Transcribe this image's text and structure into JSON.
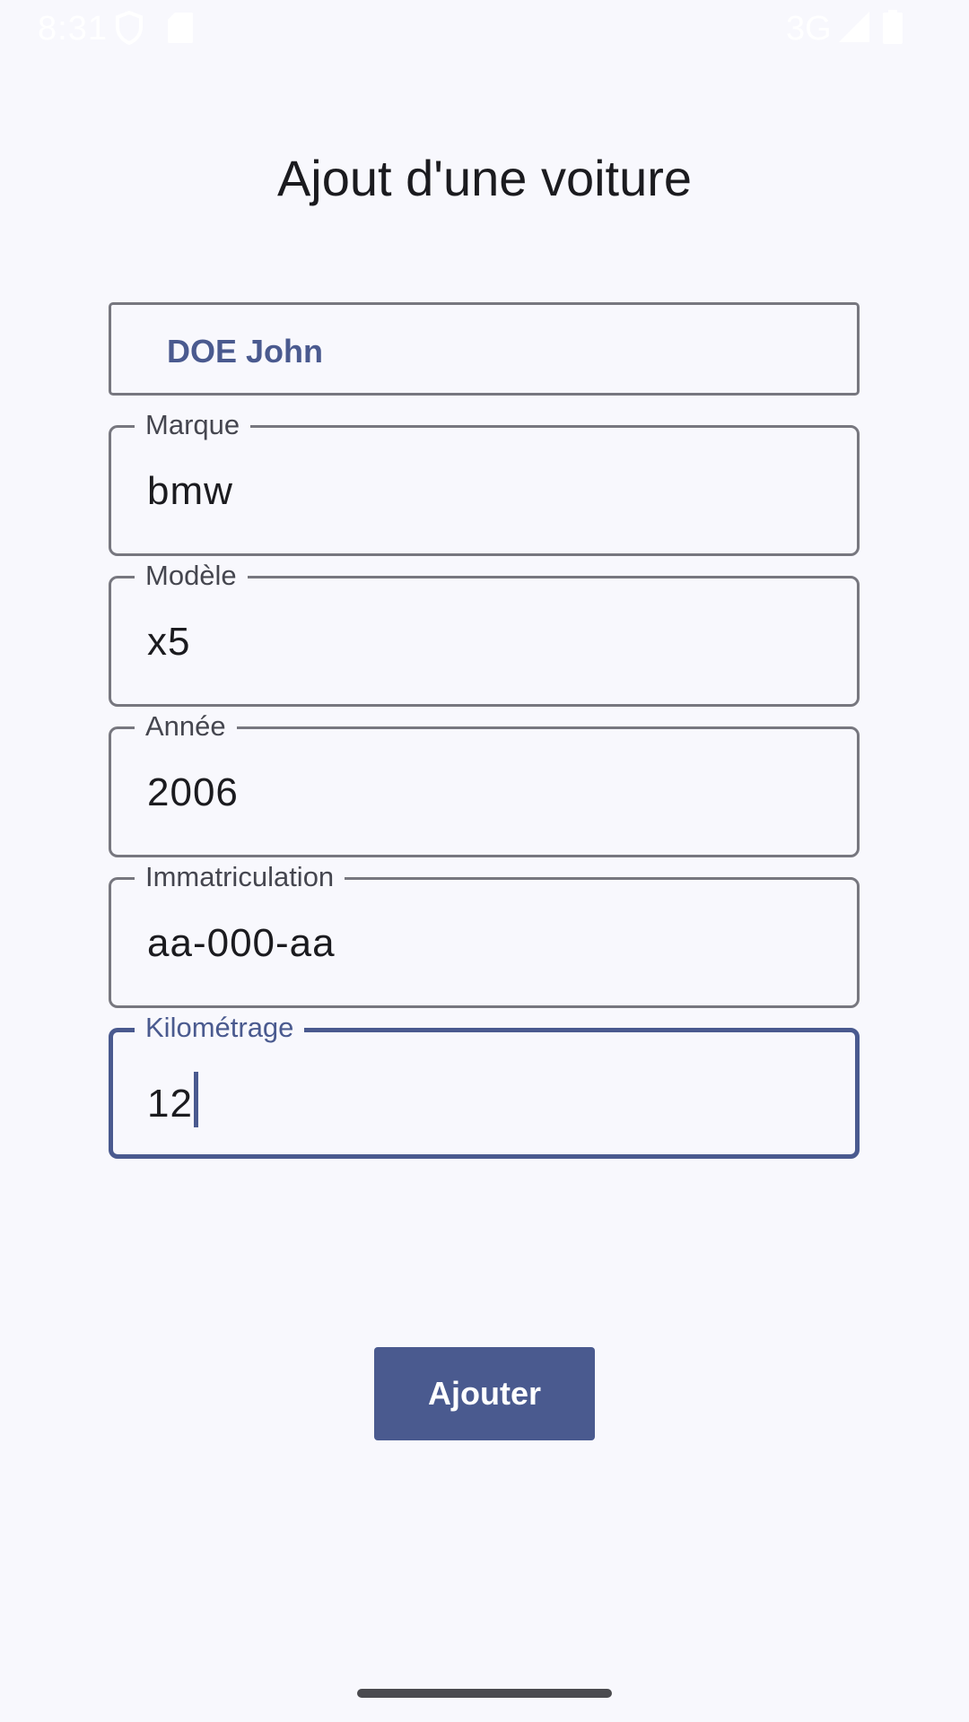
{
  "status_bar": {
    "time": "8:31",
    "network": "3G",
    "icons": [
      "shield-icon",
      "sd-card-icon",
      "signal-icon",
      "battery-icon"
    ]
  },
  "page": {
    "title": "Ajout d'une voiture"
  },
  "owner": {
    "selected": "DOE John"
  },
  "fields": {
    "marque": {
      "label": "Marque",
      "value": "bmw"
    },
    "modele": {
      "label": "Modèle",
      "value": "x5"
    },
    "annee": {
      "label": "Année",
      "value": "2006"
    },
    "immatriculation": {
      "label": "Immatriculation",
      "value": "aa-000-aa"
    },
    "kilometrage": {
      "label": "Kilométrage",
      "value": "12"
    }
  },
  "actions": {
    "add_label": "Ajouter"
  },
  "colors": {
    "background": "#f8f8fd",
    "accent": "#4a5a8f",
    "outline": "#77777f"
  }
}
